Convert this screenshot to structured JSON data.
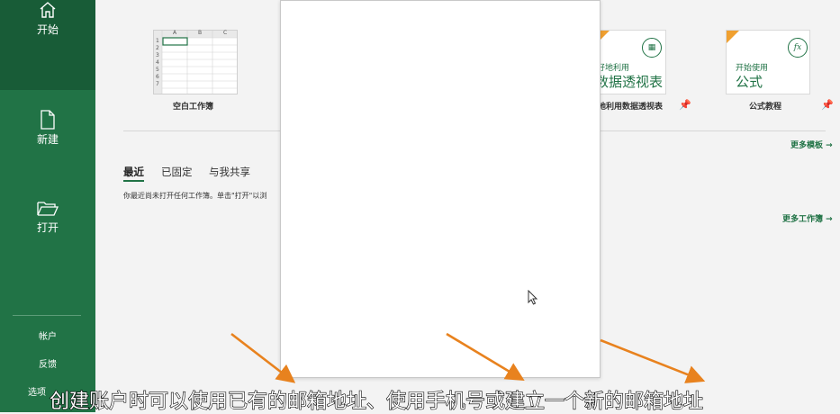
{
  "sidebar": {
    "home_label": "开始",
    "new_label": "新建",
    "open_label": "打开",
    "account_label": "帐户",
    "feedback_label": "反馈",
    "options_label": "选项",
    "bg_color": "#217346",
    "active_color": "#185c37"
  },
  "templates": {
    "blank_label": "空白工作簿",
    "blank_cols": [
      "A",
      "B",
      "C"
    ],
    "blank_rows": [
      "1",
      "2",
      "3",
      "4",
      "5",
      "6",
      "7"
    ],
    "pivot_label": "地利用数据透视表",
    "pivot_thumb_small": "好地利用",
    "pivot_thumb_big": "数据透视表",
    "formula_label": "公式教程",
    "formula_thumb_small": "开始使用",
    "formula_thumb_big": "公式",
    "formula_icon_text": "fx",
    "more_templates": "更多模板 →"
  },
  "recent": {
    "tabs": [
      "最近",
      "已固定",
      "与我共享"
    ],
    "empty_message": "你最近尚未打开任何工作簿。单击\"打开\"以浏",
    "more_workbooks": "更多工作簿 →"
  },
  "subtitle": "创建账户时可以使用已有的邮箱地址、使用手机号或建立一个新的邮箱地址",
  "accent_color": "#217346",
  "arrow_color": "#e8821e"
}
